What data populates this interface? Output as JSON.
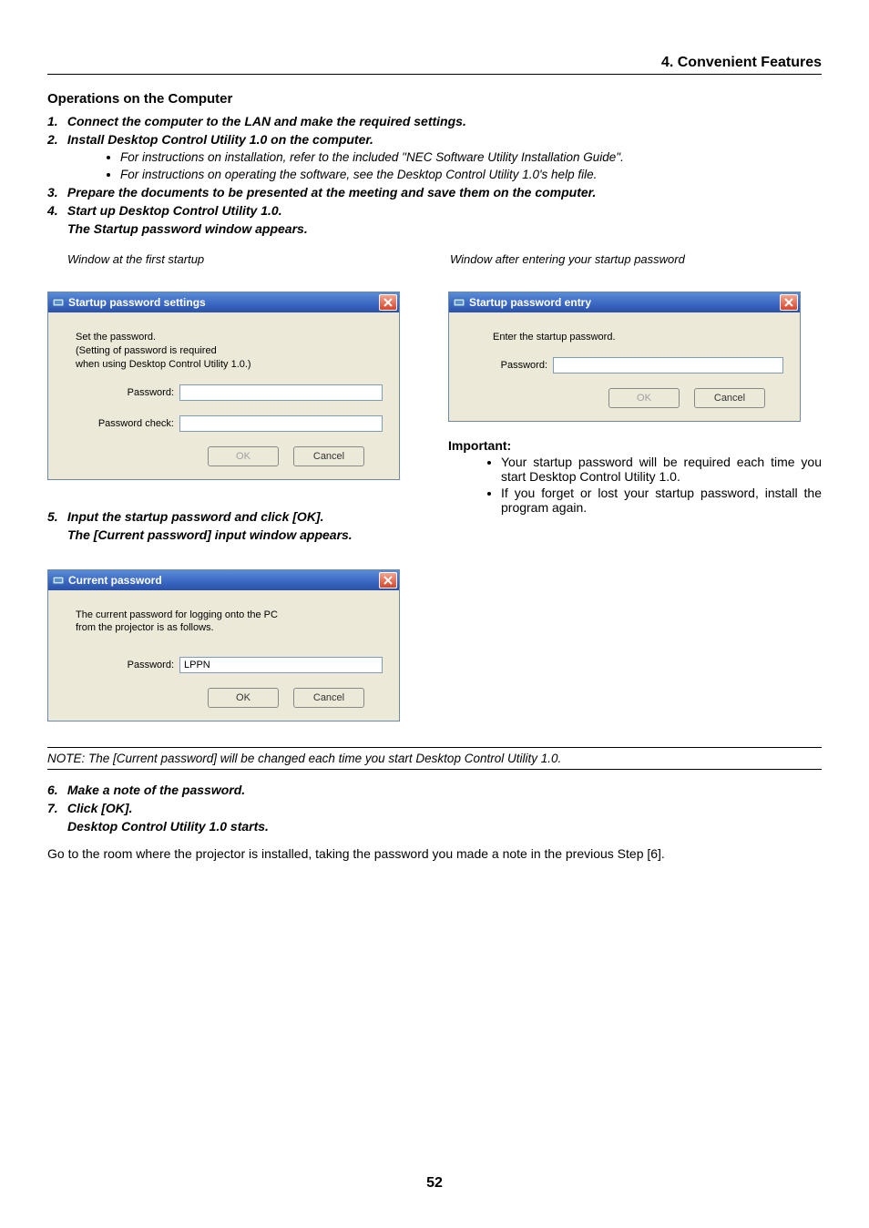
{
  "header": {
    "section": "4. Convenient Features"
  },
  "headings": {
    "ops": "Operations on the Computer"
  },
  "steps": {
    "s1": {
      "num": "1.",
      "text": "Connect the computer to the LAN and make the required settings."
    },
    "s2": {
      "num": "2.",
      "text": "Install Desktop Control Utility 1.0 on the computer."
    },
    "s2_bullets": {
      "b1": "For instructions on installation, refer to the included \"NEC Software Utility Installation Guide\".",
      "b2": "For instructions on operating the software, see the Desktop Control Utility 1.0's help file."
    },
    "s3": {
      "num": "3.",
      "text": "Prepare the documents to be presented at the meeting and save them on the computer."
    },
    "s4": {
      "num": "4.",
      "text": "Start up Desktop Control Utility 1.0."
    },
    "s4_note": "The Startup password window appears.",
    "s5": {
      "num": "5.",
      "text": "Input the startup password and click [OK]."
    },
    "s5_note": "The [Current password] input window appears.",
    "s6": {
      "num": "6.",
      "text": "Make a note of the password."
    },
    "s7": {
      "num": "7.",
      "text": "Click [OK]."
    },
    "s7_note": "Desktop Control Utility 1.0 starts."
  },
  "captions": {
    "left": "Window at the first startup",
    "right": "Window after entering your startup password"
  },
  "dialog1": {
    "title": "Startup password settings",
    "msg_line1": "Set the password.",
    "msg_line2": "(Setting of password is required",
    "msg_line3": "when using Desktop Control Utility 1.0.)",
    "pw_label": "Password:",
    "pwcheck_label": "Password check:",
    "ok": "OK",
    "cancel": "Cancel"
  },
  "dialog2": {
    "title": "Startup password entry",
    "msg": "Enter the startup password.",
    "pw_label": "Password:",
    "ok": "OK",
    "cancel": "Cancel"
  },
  "dialog3": {
    "title": "Current password",
    "msg_line1": "The current password for logging onto the PC",
    "msg_line2": "from the projector is as follows.",
    "pw_label": "Password:",
    "pw_value": "LPPN",
    "ok": "OK",
    "cancel": "Cancel"
  },
  "important": {
    "head": "Important:",
    "b1": "Your startup password will be required each time you start Desktop Control Utility 1.0.",
    "b2": "If you forget or lost your startup password, install the program again."
  },
  "note": "NOTE: The [Current password] will be changed each time you start Desktop Control Utility 1.0.",
  "closing": "Go to the room where the projector is installed, taking the password you made a note in the previous Step [6].",
  "page_number": "52"
}
